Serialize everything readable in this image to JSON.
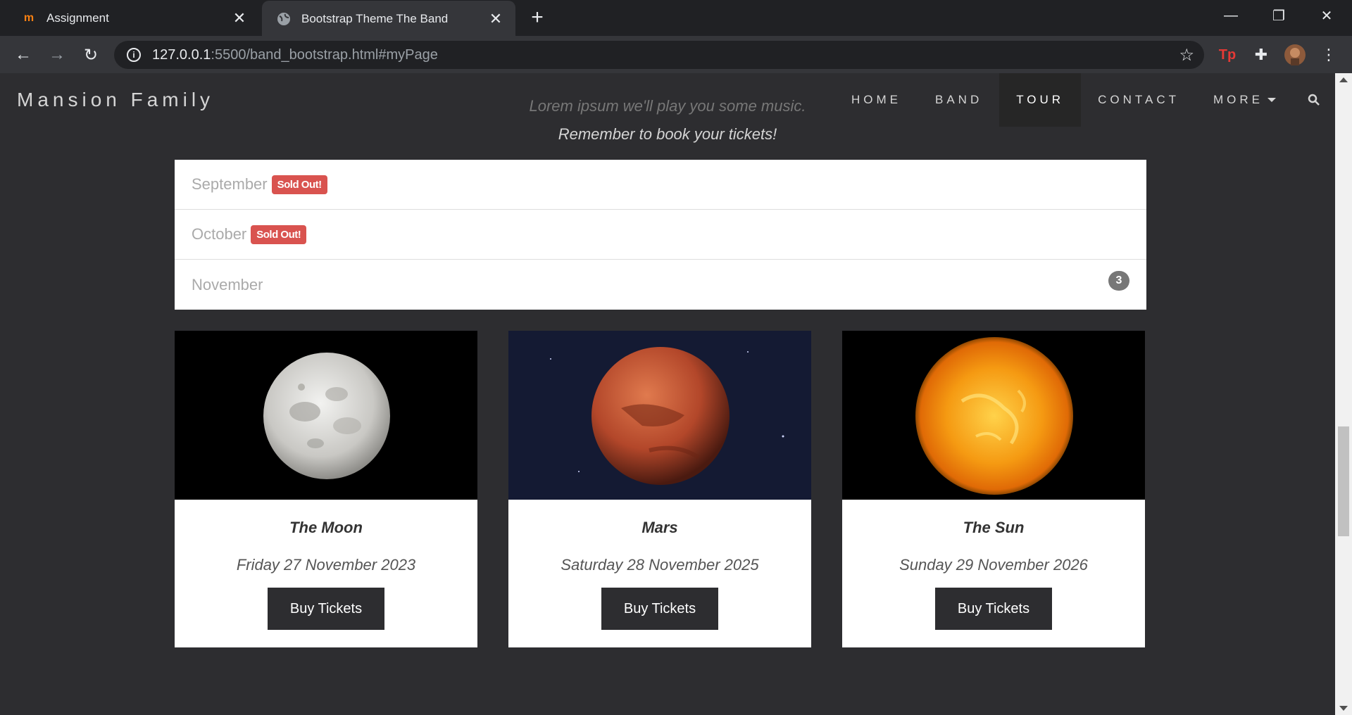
{
  "browser": {
    "tabs": [
      {
        "title": "Assignment",
        "icon": "moodle-icon",
        "active": false
      },
      {
        "title": "Bootstrap Theme The Band",
        "icon": "globe-icon",
        "active": true
      }
    ],
    "url_host": "127.0.0.1",
    "url_rest": ":5500/band_bootstrap.html#myPage"
  },
  "navbar": {
    "brand": "Mansion Family",
    "links": [
      "HOME",
      "BAND",
      "TOUR",
      "CONTACT",
      "MORE"
    ],
    "active": "TOUR"
  },
  "tour": {
    "lead": "Lorem ipsum we'll play you some music.",
    "reminder": "Remember to book your tickets!",
    "months": [
      {
        "name": "September",
        "badge": "Sold Out!"
      },
      {
        "name": "October",
        "badge": "Sold Out!"
      },
      {
        "name": "November",
        "count": "3"
      }
    ],
    "cards": [
      {
        "title": "The Moon",
        "date": "Friday 27 November 2023",
        "button": "Buy Tickets"
      },
      {
        "title": "Mars",
        "date": "Saturday 28 November 2025",
        "button": "Buy Tickets"
      },
      {
        "title": "The Sun",
        "date": "Sunday 29 November 2026",
        "button": "Buy Tickets"
      }
    ]
  },
  "colors": {
    "soldout": "#d9534f",
    "page_bg": "#2d2d30",
    "badge": "#777777"
  }
}
